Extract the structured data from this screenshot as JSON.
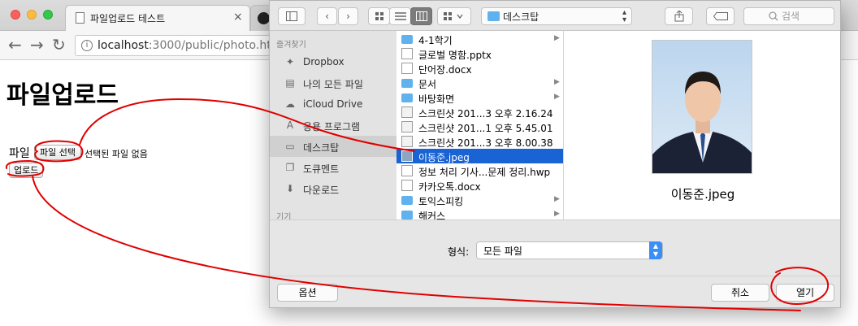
{
  "browser": {
    "tab_title": "파일업로드 테스트",
    "tab_close": "×",
    "url_host": "localhost",
    "url_path": ":3000/public/photo.html",
    "nav": {
      "back": "←",
      "forward": "→",
      "reload": "↻"
    }
  },
  "page": {
    "heading": "파일업로드",
    "file_label": "파일",
    "choose_button": "파일 선택",
    "no_file_text": "선택된 파일 없음",
    "upload_button": "업로드"
  },
  "dialog": {
    "location": "데스크탑",
    "search_placeholder": "검색",
    "sidebar": {
      "favorites_header": "즐겨찾기",
      "items": [
        {
          "label": "Dropbox",
          "icon": "dropbox-icon"
        },
        {
          "label": "나의 모든 파일",
          "icon": "all-files-icon"
        },
        {
          "label": "iCloud Drive",
          "icon": "cloud-icon"
        },
        {
          "label": "응용 프로그램",
          "icon": "applications-icon"
        },
        {
          "label": "데스크탑",
          "icon": "desktop-icon",
          "selected": true
        },
        {
          "label": "도큐멘트",
          "icon": "document-icon"
        },
        {
          "label": "다운로드",
          "icon": "download-icon"
        }
      ],
      "devices_header": "기기"
    },
    "files": [
      {
        "name": "4-1학기",
        "type": "folder"
      },
      {
        "name": "글로벌 명함.pptx",
        "type": "doc"
      },
      {
        "name": "단어장.docx",
        "type": "doc"
      },
      {
        "name": "문서",
        "type": "folder"
      },
      {
        "name": "바탕화면",
        "type": "folder"
      },
      {
        "name": "스크린샷 201...3 오후 2.16.24",
        "type": "shot"
      },
      {
        "name": "스크린샷 201...1 오후 5.45.01",
        "type": "shot"
      },
      {
        "name": "스크린샷 201...3 오후 8.00.38",
        "type": "shot"
      },
      {
        "name": "이동준.jpeg",
        "type": "photo",
        "selected": true
      },
      {
        "name": "정보 처리 기사...문제 정리.hwp",
        "type": "doc"
      },
      {
        "name": "카카오톡.docx",
        "type": "doc"
      },
      {
        "name": "토익스피킹",
        "type": "folder"
      },
      {
        "name": "해커스",
        "type": "folder"
      }
    ],
    "preview_name": "이동준.jpeg",
    "format_label": "형식:",
    "format_value": "모든 파일",
    "options_button": "옵션",
    "cancel_button": "취소",
    "open_button": "열기"
  },
  "colors": {
    "selection": "#1a63d4",
    "folder": "#5fb2ee",
    "annotation": "#e00000"
  }
}
